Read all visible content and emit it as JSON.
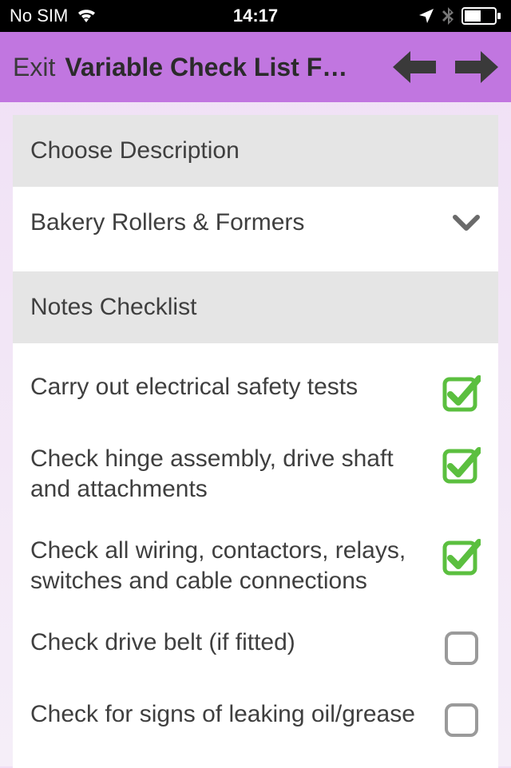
{
  "statusbar": {
    "carrier": "No SIM",
    "time": "14:17"
  },
  "navbar": {
    "exit_label": "Exit",
    "title": "Variable Check List Fo…"
  },
  "sections": {
    "description_header": "Choose Description",
    "description_value": "Bakery Rollers & Formers",
    "checklist_header": "Notes Checklist"
  },
  "checklist": [
    {
      "label": "Carry out electrical safety tests",
      "checked": true
    },
    {
      "label": "Check  hinge assembly, drive shaft and attachments",
      "checked": true
    },
    {
      "label": "Check all wiring, contactors, relays, switches and cable connections",
      "checked": true
    },
    {
      "label": "Check drive belt (if fitted)",
      "checked": false
    },
    {
      "label": "Check for signs of leaking oil/grease",
      "checked": false
    }
  ],
  "colors": {
    "accent": "#c176e0",
    "check_green": "#5bbf3f",
    "box_grey": "#9a9a9a"
  }
}
